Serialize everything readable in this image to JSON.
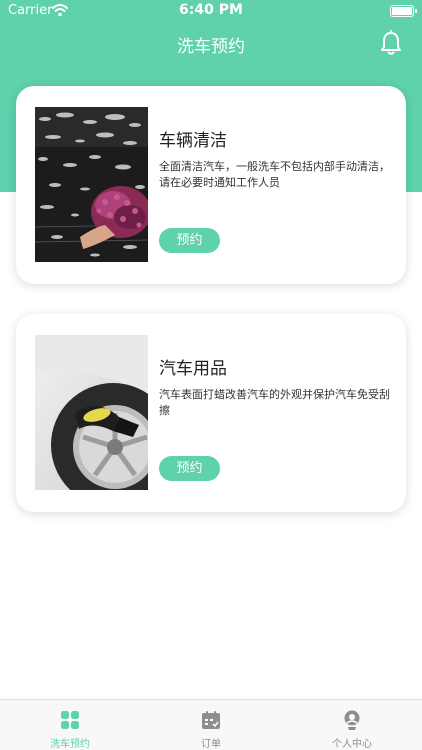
{
  "status_bar": {
    "carrier": "Carrier",
    "time": "6:40 PM"
  },
  "nav": {
    "title": "洗车预约",
    "bell_icon": "bell-icon"
  },
  "services": [
    {
      "title": "车辆清洁",
      "description": "全面清洁汽车，一般洗车不包括内部手动清洁，请在必要时通知工作人员",
      "button": "预约",
      "image": "car-wash-mitt-photo"
    },
    {
      "title": "汽车用品",
      "description": "汽车表面打蜡改善汽车的外观并保护汽车免受刮擦",
      "button": "预约",
      "image": "wheel-polish-photo"
    }
  ],
  "tabbar": {
    "items": [
      {
        "label": "洗车预约",
        "icon": "grid-icon",
        "active": true
      },
      {
        "label": "订单",
        "icon": "calendar-icon",
        "active": false
      },
      {
        "label": "个人中心",
        "icon": "profile-icon",
        "active": false
      }
    ]
  },
  "colors": {
    "accent": "#5fd1ad",
    "inactive": "#8e8e8e"
  }
}
